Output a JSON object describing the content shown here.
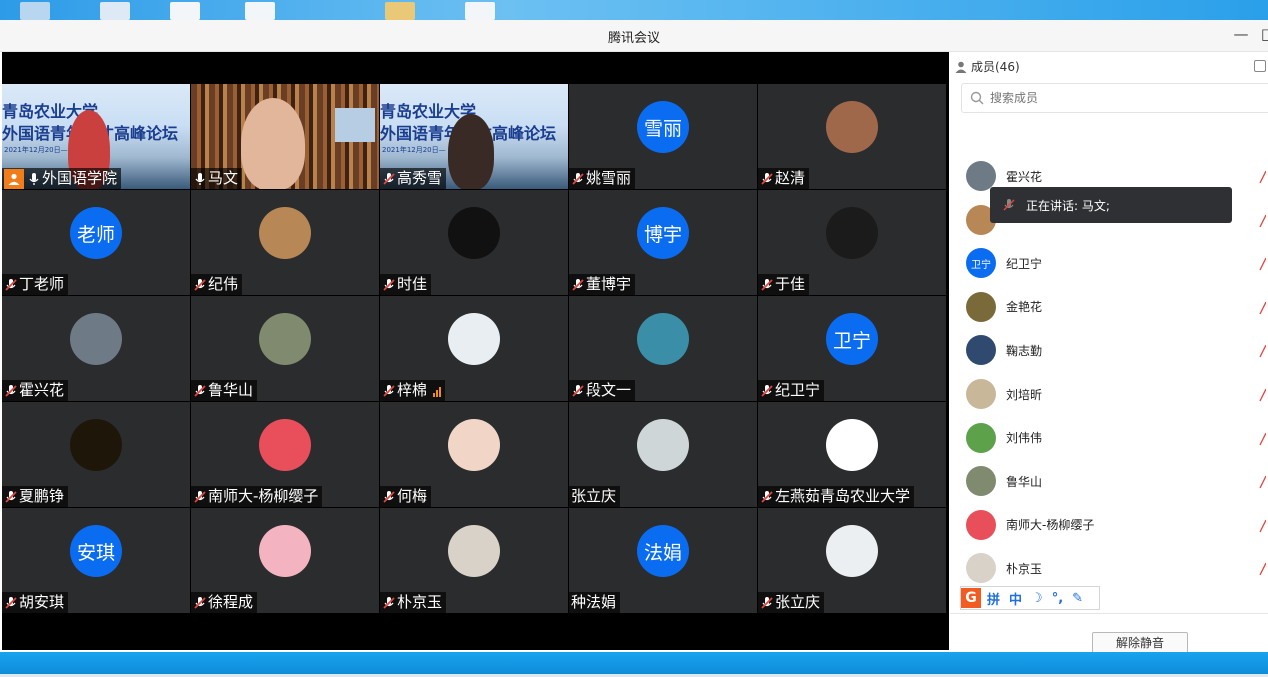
{
  "window": {
    "title": "腾讯会议"
  },
  "desktop": {
    "colors": {
      "sky": "#1a8fdc"
    }
  },
  "grid": {
    "tiles": [
      {
        "name": "外国语学院",
        "kind": "video",
        "host": true,
        "mic": "on"
      },
      {
        "name": "马文",
        "kind": "video",
        "mic": "on",
        "active": true
      },
      {
        "name": "高秀雪",
        "kind": "video",
        "mic": "muted"
      },
      {
        "name": "姚雪丽",
        "kind": "initials",
        "initials": "雪丽",
        "mic": "muted"
      },
      {
        "name": "赵清",
        "kind": "photo",
        "avatar_color": "#a0684a",
        "mic": "muted"
      },
      {
        "name": "丁老师",
        "kind": "initials",
        "initials": "老师",
        "mic": "muted"
      },
      {
        "name": "纪伟",
        "kind": "photo",
        "avatar_color": "#b88756",
        "mic": "muted"
      },
      {
        "name": "时佳",
        "kind": "photo",
        "avatar_color": "#111111",
        "mic": "muted"
      },
      {
        "name": "董博宇",
        "kind": "initials",
        "initials": "博宇",
        "mic": "muted"
      },
      {
        "name": "于佳",
        "kind": "photo",
        "avatar_color": "#1b1b1b",
        "mic": "muted"
      },
      {
        "name": "霍兴花",
        "kind": "photo",
        "avatar_color": "#6e7a86",
        "mic": "muted"
      },
      {
        "name": "鲁华山",
        "kind": "photo",
        "avatar_color": "#7f8a6e",
        "mic": "muted"
      },
      {
        "name": "梓棉",
        "kind": "photo",
        "avatar_color": "#e9eef2",
        "mic": "muted",
        "signal": true
      },
      {
        "name": "段文一",
        "kind": "photo",
        "avatar_color": "#3a8ea8",
        "mic": "muted"
      },
      {
        "name": "纪卫宁",
        "kind": "initials",
        "initials": "卫宁",
        "mic": "muted"
      },
      {
        "name": "夏鹏铮",
        "kind": "photo",
        "avatar_color": "#1d1609",
        "mic": "muted"
      },
      {
        "name": "南师大-杨柳缨子",
        "kind": "photo",
        "avatar_color": "#e94f5b",
        "mic": "muted"
      },
      {
        "name": "何梅",
        "kind": "photo",
        "avatar_color": "#f1d6c8",
        "mic": "muted"
      },
      {
        "name": "张立庆",
        "kind": "photo",
        "avatar_color": "#cfd6d8",
        "mic": "none"
      },
      {
        "name": "左燕茹青岛农业大学",
        "kind": "photo",
        "avatar_color": "#ffffff",
        "mic": "muted"
      },
      {
        "name": "胡安琪",
        "kind": "initials",
        "initials": "安琪",
        "mic": "muted"
      },
      {
        "name": "徐程成",
        "kind": "photo",
        "avatar_color": "#f4b3c1",
        "mic": "muted"
      },
      {
        "name": "朴京玉",
        "kind": "photo",
        "avatar_color": "#d8d2c8",
        "mic": "muted"
      },
      {
        "name": "种法娟",
        "kind": "initials",
        "initials": "法娟",
        "mic": "none"
      },
      {
        "name": "张立庆",
        "kind": "photo",
        "avatar_color": "#eceff1",
        "mic": "muted"
      }
    ],
    "banner": {
      "line1": "青岛农业大学",
      "line2": "外国语青年人才高峰论坛",
      "date": "2021年12月20日—"
    },
    "colors": {
      "tile": "#2b2c2e",
      "initials_bg": "#0a6cf0",
      "host": "#f07c1a",
      "muted": "#e3453d"
    }
  },
  "sidebar": {
    "members_label": "成员(46)",
    "search_placeholder": "搜索成员",
    "members": [
      {
        "name": "霍兴花",
        "avatar_color": "#6e7a86"
      },
      {
        "name": "",
        "avatar_color": "#b88756"
      },
      {
        "name": "纪卫宁",
        "avatar_color": "#0a6cf0",
        "initials": "卫宁"
      },
      {
        "name": "金艳花",
        "avatar_color": "#7a6a3a"
      },
      {
        "name": "鞠志勤",
        "avatar_color": "#2f4a6e"
      },
      {
        "name": "刘培昕",
        "avatar_color": "#c9b79a"
      },
      {
        "name": "刘伟伟",
        "avatar_color": "#5da24a"
      },
      {
        "name": "鲁华山",
        "avatar_color": "#7f8a6e"
      },
      {
        "name": "南师大-杨柳缨子",
        "avatar_color": "#e94f5b"
      },
      {
        "name": "朴京玉",
        "avatar_color": "#d8d2c8"
      }
    ],
    "speaking_tooltip": "正在讲话: 马文;",
    "ime": {
      "logo": "G",
      "items": [
        "拼",
        "中",
        "☽",
        "°,",
        "✎"
      ]
    },
    "unmute_label": "解除静音"
  }
}
